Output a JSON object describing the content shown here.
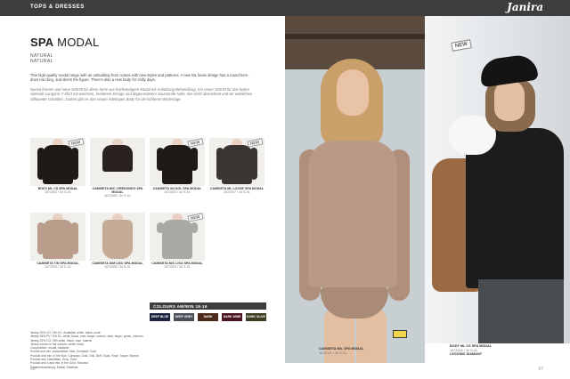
{
  "topbar": {
    "section": "TOPS & DRESSES",
    "brand": "Janira"
  },
  "header": {
    "title_bold": "SPA",
    "title_rest": " MODAL",
    "subtitle_1": "NATURAL",
    "subtitle_2": "NATURAL"
  },
  "description": {
    "en": "This high-quality modal range with an unbuilding from comes with new styles and patterns. A new ML loose design has a round hem - does not cling, and skims the figure. There's also a new body for chilly days.",
    "es": "Nueva formen and neue Schnitt für diese Serie aus hochwertigem Modal mit Anbüßung-Behandlung. Ein neuer Schnitt für das locker sitzende Langarm-T-Shirt mit weichem, breiterem Design und abgerundetem Saumende-Naht, das nicht abzeichnet und wir weiblichen Silhouette schattiert. Zudem gibt es den neuen Ädelingen Body für die kühleren Wintertage."
  },
  "products": [
    {
      "name": "BODY ML CS SPA MODAL",
      "ref": "1672002 / 34 S-XL",
      "badge": "NEW",
      "color": "#1f1a18"
    },
    {
      "name": "CAMISETA M/C C/REDONDO SPA MODAL",
      "ref": "1672006 / 34 S-XL",
      "badge": "",
      "color": "#2a2220"
    },
    {
      "name": "CAMISETA 3/4 SOL SPA MODAL",
      "ref": "1672003 / 34 S-XL",
      "badge": "NEW",
      "color": "#1e1a18"
    },
    {
      "name": "CAMISETA ML LOOSE SPA MODAL",
      "ref": "1672007 / 34 S-XL",
      "badge": "NEW",
      "color": "#3a3532"
    },
    {
      "name": "CAMISETA T/N SPA MODAL",
      "ref": "1672000 / 34 S-XL",
      "badge": "",
      "color": "#b99d8a"
    },
    {
      "name": "CAMISETA S/M LISO SPA MODAL",
      "ref": "1672008 / 34 S-XL",
      "badge": "",
      "color": "#c4ab96"
    },
    {
      "name": "CAMISETA M/C LISO SPA MODAL",
      "ref": "1672004 / 34 S-XL",
      "badge": "NEW",
      "color": "#a9a9a4"
    }
  ],
  "colours": {
    "header": "COLOURS AW/WIN 18-19",
    "swatches": [
      {
        "label": "DEEP BLUE",
        "color": "#1c2540"
      },
      {
        "label": "DEEP GREY",
        "color": "#4a4e57"
      },
      {
        "label": "DARK BROWN",
        "color": "#4b2a1c"
      },
      {
        "label": "DARK WINE",
        "color": "#4a1422"
      },
      {
        "label": "DARK OLIVE",
        "color": "#3c3d22"
      }
    ]
  },
  "notes": [
    "Jersey 92% CO / 8% EL. Available: white, black, nude",
    "Jersey 94% PV / 6% EL. white, black, rose, taupe, marron, dark, taupe, green, crimson",
    "Jersey 92% CO / 8% white, black, rose, marron",
    "Jersey modal: in the colours: white, black",
    "Composition: modal, elastane",
    "Produit and mix: composition: Noir, Compact, Gold",
    "Produkt and mix: in the Noir, Compact, Gold, Gris, Buff, Soda, Rose, Taupe, Marron",
    "Produkt mix: Nachtblau, Grau, Rost",
    "Produkt and a and mix: in the Gold, Schwarz",
    "Zusammensetzung: Modal, Elasthan"
  ],
  "page_numbers": {
    "left": "66",
    "right": "67"
  },
  "photo_captions": {
    "left_name": "CAMISETA M/L SPA MODAL",
    "left_ref": "1672001 / 34 S-XL",
    "right_name": "BODY ML CS SPA MODAL",
    "right_ref": "1672002 / 34 S-XL",
    "right_extra": "LEGGING DIAMANT"
  },
  "photo_badge": "NEW"
}
